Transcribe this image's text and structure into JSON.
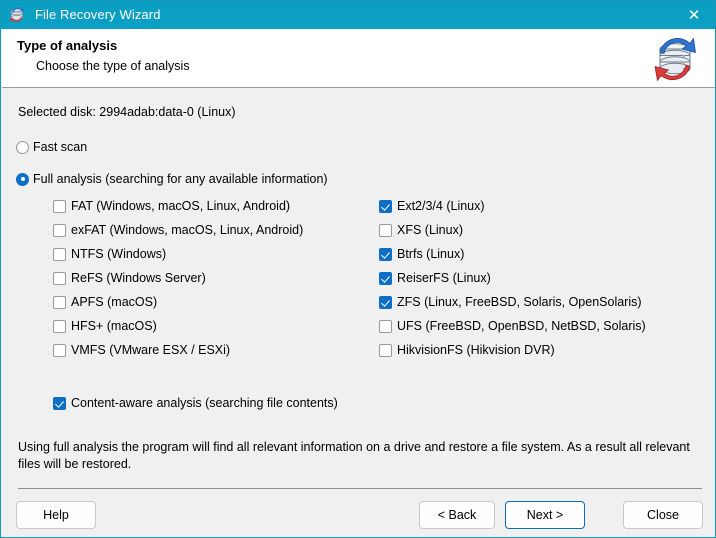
{
  "window": {
    "title": "File Recovery Wizard",
    "app_icon": "disk-recovery-icon",
    "close_label": "✕",
    "accent_color": "#0b9fc4",
    "checked_color": "#0d6fc4"
  },
  "header": {
    "title": "Type of analysis",
    "subtitle": "Choose the type of analysis",
    "icon": "disk-stack-arrows-icon"
  },
  "main": {
    "selected_disk": "Selected disk: 2994adab:data-0 (Linux)",
    "scan_modes": [
      {
        "label": "Fast scan",
        "checked": false
      },
      {
        "label": "Full analysis (searching for any available information)",
        "checked": true
      }
    ],
    "filesystems_left": [
      {
        "label": "FAT (Windows, macOS, Linux, Android)",
        "checked": false
      },
      {
        "label": "exFAT (Windows, macOS, Linux, Android)",
        "checked": false
      },
      {
        "label": "NTFS (Windows)",
        "checked": false
      },
      {
        "label": "ReFS (Windows Server)",
        "checked": false
      },
      {
        "label": "APFS (macOS)",
        "checked": false
      },
      {
        "label": "HFS+ (macOS)",
        "checked": false
      },
      {
        "label": "VMFS (VMware ESX / ESXi)",
        "checked": false
      }
    ],
    "filesystems_right": [
      {
        "label": "Ext2/3/4 (Linux)",
        "checked": true
      },
      {
        "label": "XFS (Linux)",
        "checked": false
      },
      {
        "label": "Btrfs (Linux)",
        "checked": true
      },
      {
        "label": "ReiserFS (Linux)",
        "checked": true
      },
      {
        "label": "ZFS (Linux, FreeBSD, Solaris, OpenSolaris)",
        "checked": true
      },
      {
        "label": "UFS (FreeBSD, OpenBSD, NetBSD, Solaris)",
        "checked": false
      },
      {
        "label": "HikvisionFS (Hikvision DVR)",
        "checked": false
      }
    ],
    "content_aware": {
      "label": "Content-aware analysis (searching file contents)",
      "checked": true
    },
    "description": "Using full analysis the program will find all relevant information on a drive and restore a file system. As a result all relevant files will be restored."
  },
  "footer": {
    "help_label": "Help",
    "back_label": "< Back",
    "next_label": "Next >",
    "close_label": "Close"
  }
}
